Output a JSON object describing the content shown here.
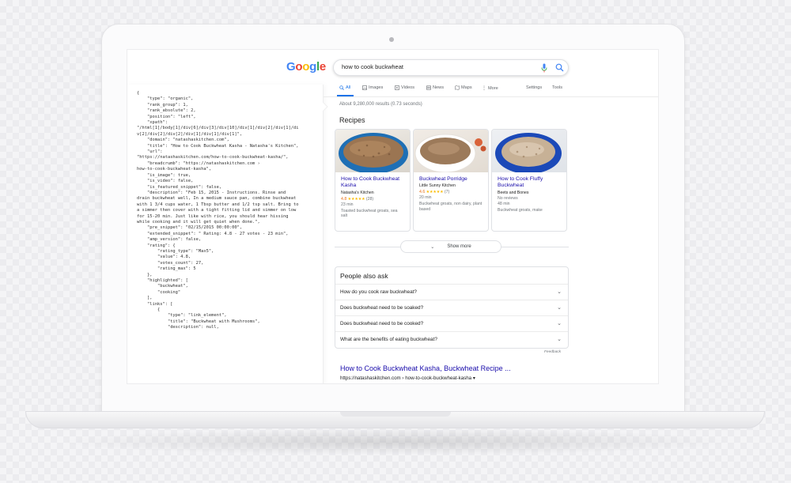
{
  "search": {
    "logo": "Google",
    "query": "how to cook buckwheat"
  },
  "tabs": [
    {
      "label": "All",
      "icon": "search-icon"
    },
    {
      "label": "Images",
      "icon": "image-icon"
    },
    {
      "label": "Videos",
      "icon": "video-icon"
    },
    {
      "label": "News",
      "icon": "news-icon"
    },
    {
      "label": "Maps",
      "icon": "map-icon"
    },
    {
      "label": "More",
      "icon": "more-icon"
    }
  ],
  "tools": {
    "settings": "Settings",
    "tools": "Tools"
  },
  "result_stats": "About 9,280,000 results (0.73 seconds)",
  "recipes": {
    "title": "Recipes",
    "cards": [
      {
        "title": "How to Cook Buckwheat Kasha",
        "source": "Natasha's Kitchen",
        "rating": "4.8",
        "stars": "★★★★★",
        "votes": "(28)",
        "time": "23 min",
        "desc": "Toasted buckwheat groats, sea salt"
      },
      {
        "title": "Buckwheat Porridge",
        "source": "Little Sunny Kitchen",
        "rating": "4.6",
        "stars": "★★★★★",
        "votes": "(7)",
        "time": "20 min",
        "desc": "Buckwheat groats, non dairy, plant based"
      },
      {
        "title": "How to Cook Fluffy Buckwheat",
        "source": "Beets and Bones",
        "rating_text": "No reviews",
        "time": "48 min",
        "desc": "Buckwheat groats, make"
      }
    ],
    "show_more": "Show more"
  },
  "people_also_ask": {
    "title": "People also ask",
    "questions": [
      "How do you cook raw buckwheat?",
      "Does buckwheat need to be soaked?",
      "Does buckwheat need to be cooked?",
      "What are the benefits of eating buckwheat?"
    ],
    "feedback": "Feedback"
  },
  "organic_result": {
    "title": "How to Cook Buckwheat Kasha, Buckwheat Recipe ...",
    "url": "https://natashaskitchen.com › how-to-cook-buckwheat-kasha ▾"
  },
  "json_lines": [
    "{",
    "    \"type\": \"organic\",",
    "    \"rank_group\": 1,",
    "    \"rank_absolute\": 2,",
    "    \"position\": \"left\",",
    "    \"xpath\":",
    "\"/html[1]/body[1]/div[6]/div[3]/div[10]/div[1]/div[2]/div[1]/di",
    "v[2]/div[2]/div[2]/div[1]/div[1]/div[1]\",",
    "    \"domain\": \"natashaskitchen.com\",",
    "    \"title\": \"How to Cook Buckwheat Kasha - Natasha's Kitchen\",",
    "    \"url\":",
    "\"https://natashaskitchen.com/how-to-cook-buckwheat-kasha/\",",
    "    \"breadcrumb\": \"https://natashaskitchen.com ›",
    "how-to-cook-buckwheat-kasha\",",
    "    \"is_image\": true,",
    "    \"is_video\": false,",
    "    \"is_featured_snippet\": false,",
    "    \"description\": \"Feb 15, 2015 - Instructions. Rinse and",
    "drain buckwheat well, In a medium sauce pan, combine buckwheat",
    "with 1 3/4 cups water, 1 Tbsp butter and 1/2 tsp salt. Bring to",
    "a simmer then cover with a tight fitting lid and simmer on low",
    "for 15-20 min. Just like with rice, you should hear hissing",
    "while cooking and it will get quiet when done.\",",
    "    \"pre_snippet\": \"02/15/2015 00:00:00\",",
    "    \"extended_snippet\": \" Rating: 4.8 - 27 votes - 23 min\",",
    "    \"amp_version\": false,",
    "    \"rating\": {",
    "        \"rating_type\": \"Max5\",",
    "        \"value\": 4.8,",
    "        \"votes_count\": 27,",
    "        \"rating_max\": 5",
    "    },",
    "    \"highlighted\": [",
    "        \"buckwheat\",",
    "        \"cooking\"",
    "    ],",
    "    \"links\": [",
    "        {",
    "            \"type\": \"link_element\",",
    "            \"title\": \"Buckwheat with Mushrooms\",",
    "            \"description\": null,"
  ],
  "colors": {
    "link": "#1a0dab",
    "accent": "#1a73e8",
    "stars": "#fbbc04",
    "rating_num": "#e7711b"
  }
}
